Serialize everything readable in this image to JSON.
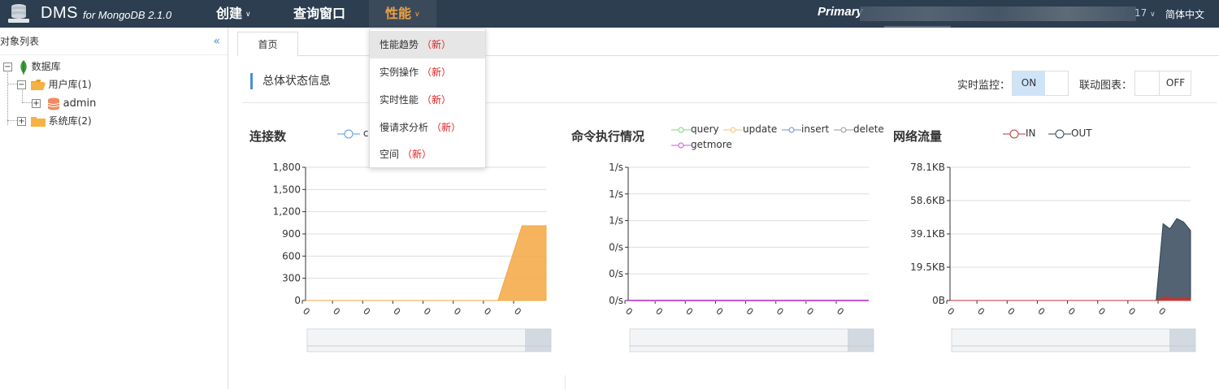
{
  "topbar": {
    "brand": "DMS",
    "brand_sub": "for MongoDB 2.1.0",
    "nav": [
      {
        "label": "创建",
        "has_caret": true
      },
      {
        "label": "查询窗口",
        "has_caret": false
      },
      {
        "label": "性能",
        "has_caret": true,
        "active": true
      }
    ],
    "primary_label": "Primary",
    "version_fragment": "17",
    "language": "简体中文"
  },
  "left_panel": {
    "title": "对象列表",
    "collapse_icon": "double-chevron-left-icon",
    "tree": [
      {
        "label": "数据库",
        "icon": "mongodb-leaf-icon",
        "expanded": true,
        "level": 0
      },
      {
        "label": "用户库(1)",
        "icon": "folder-open-icon",
        "expanded": true,
        "level": 1
      },
      {
        "label": "admin",
        "icon": "database-icon",
        "expanded": false,
        "level": 2
      },
      {
        "label": "系统库(2)",
        "icon": "folder-icon",
        "expanded": false,
        "level": 1
      }
    ]
  },
  "main": {
    "tab": "首页",
    "section_title": "总体状态信息",
    "realtime_label": "实时监控：",
    "realtime_on": "ON",
    "linked_label": "联动图表：",
    "linked_off": "OFF"
  },
  "dropdown": {
    "new_tag": "（新）",
    "items": [
      {
        "label": "性能趋势",
        "hover": true
      },
      {
        "label": "实例操作"
      },
      {
        "label": "实时性能"
      },
      {
        "label": "慢请求分析"
      },
      {
        "label": "空间"
      }
    ]
  },
  "colors": {
    "topbar": "#2c3e50",
    "active_nav": "#f0a040",
    "new_tag": "#e02020",
    "accent": "#4a90d9"
  },
  "chart_data": [
    {
      "type": "area",
      "title": "连接数",
      "legend": [
        {
          "name": "c",
          "color": "#5b9bd5"
        }
      ],
      "yticks": [
        "1,800",
        "1,500",
        "1,200",
        "900",
        "600",
        "300",
        "0"
      ],
      "ylim": [
        0,
        1800
      ],
      "xticks": [
        "0",
        "0",
        "0",
        "0",
        "0",
        "0",
        "0",
        "0"
      ],
      "series": [
        {
          "name": "c",
          "color": "#f5a742",
          "values": [
            0,
            0,
            0,
            0,
            0,
            0,
            0,
            0,
            0,
            1010,
            1010
          ]
        }
      ]
    },
    {
      "type": "line",
      "title": "命令执行情况",
      "legend": [
        {
          "name": "query",
          "color": "#7ed67e"
        },
        {
          "name": "update",
          "color": "#f5c26b"
        },
        {
          "name": "insert",
          "color": "#6b8fd6"
        },
        {
          "name": "delete",
          "color": "#999999"
        },
        {
          "name": "getmore",
          "color": "#c35ad8"
        }
      ],
      "yticks": [
        "1/s",
        "1/s",
        "1/s",
        "0/s",
        "0/s",
        "0/s"
      ],
      "xticks": [
        "0",
        "0",
        "0",
        "0",
        "0",
        "0",
        "0",
        "0"
      ],
      "series": [
        {
          "name": "getmore",
          "color": "#c35ad8",
          "values": [
            0,
            0,
            0,
            0,
            0,
            0,
            0,
            0
          ]
        }
      ]
    },
    {
      "type": "area",
      "title": "网络流量",
      "legend": [
        {
          "name": "IN",
          "color": "#c23531"
        },
        {
          "name": "OUT",
          "color": "#2f4554"
        }
      ],
      "yticks": [
        "78.1KB",
        "58.6KB",
        "39.1KB",
        "19.5KB",
        "0B"
      ],
      "ylim": [
        0,
        78.1
      ],
      "xticks": [
        "0",
        "0",
        "0",
        "0",
        "0",
        "0",
        "0",
        "0"
      ],
      "series": [
        {
          "name": "OUT",
          "color": "#4a5b6b",
          "values": [
            0,
            0,
            0,
            0,
            0,
            0,
            0,
            0,
            0,
            0,
            0,
            0,
            0,
            0,
            0,
            0,
            0,
            0,
            0,
            0,
            0,
            0,
            0,
            0,
            0,
            0,
            0,
            0,
            0,
            0,
            0,
            45,
            42,
            48,
            46,
            41
          ]
        },
        {
          "name": "IN",
          "color": "#c23531",
          "values": [
            0,
            0,
            0,
            0,
            0,
            0,
            0,
            0,
            0,
            0,
            0,
            0,
            0,
            0,
            0,
            0,
            0,
            0,
            0,
            0,
            0,
            0,
            0,
            0,
            0,
            0,
            0,
            0,
            0,
            0,
            0,
            2,
            2,
            1,
            2,
            1
          ]
        }
      ]
    }
  ]
}
